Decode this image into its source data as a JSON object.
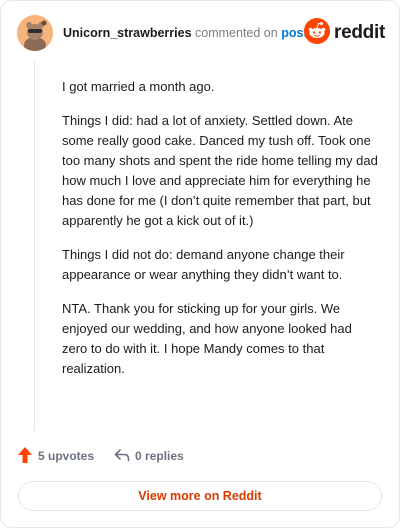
{
  "comment": {
    "username": "Unicorn_strawberries",
    "action_text": "commented on",
    "target_link": "post",
    "paragraphs": [
      "I got married a month ago.",
      "Things I did: had a lot of anxiety. Settled down. Ate some really good cake. Danced my tush off. Took one too many shots and spent the ride home telling my dad how much I love and appreciate him for everything he has done for me (I don’t quite remember that part, but apparently he got a kick out of it.)",
      "Things I did not do: demand anyone change their appearance or wear anything they didn’t want to.",
      "NTA. Thank you for sticking up for your girls. We enjoyed our wedding, and how anyone looked had zero to do with it. I hope Mandy comes to that realization."
    ]
  },
  "brand": {
    "wordmark": "reddit",
    "color": "#ff4500"
  },
  "footer": {
    "upvotes_label": "5 upvotes",
    "replies_label": "0 replies",
    "view_more_label": "View more on Reddit"
  },
  "icons": {
    "avatar": "avatar-icon",
    "logo": "reddit-logo-icon",
    "upvote": "upvote-arrow-icon",
    "reply": "reply-arrow-icon"
  }
}
